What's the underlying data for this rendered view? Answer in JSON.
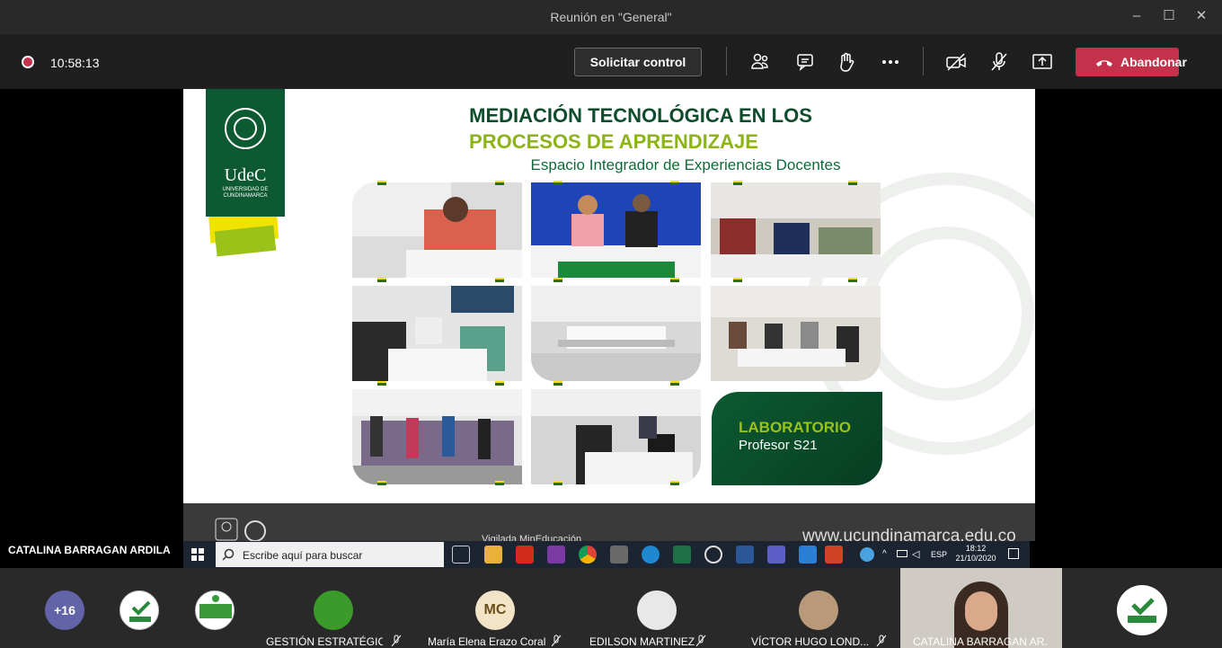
{
  "window": {
    "title": "Reunión en \"General\"",
    "controls": {
      "minimize": "–",
      "maximize": "☐",
      "close": "✕"
    }
  },
  "meeting_bar": {
    "timer": "10:58:13",
    "request_control_label": "Solicitar control",
    "leave_label": "Abandonar",
    "tools": [
      "participants-icon",
      "chat-icon",
      "raise-hand-icon",
      "more-icon",
      "camera-off-icon",
      "mic-off-icon",
      "share-tray-icon"
    ]
  },
  "slide": {
    "title_line1": "MEDIACIÓN TECNOLÓGICA EN LOS",
    "title_line2": "PROCESOS DE APRENDIZAJE",
    "subtitle": "Espacio Integrador de Experiencias Docentes",
    "logo": {
      "name": "UdeC",
      "university": "UNIVERSIDAD DE CUNDINAMARCA"
    },
    "lab_card": {
      "title": "LABORATORIO",
      "subtitle": "Profesor S21"
    },
    "footer": {
      "vigilada": "Vigilada MinEducación",
      "url": "www.ucundinamarca.edu.co"
    },
    "colors": {
      "dark_green": "#0e4d2b",
      "lime": "#8cb415",
      "yellow": "#f2e200"
    }
  },
  "presenter": {
    "name": "CATALINA BARRAGAN ARDILA"
  },
  "taskbar": {
    "search_placeholder": "Escribe aquí para buscar",
    "language": "ESP",
    "time": "18:12",
    "date": "21/10/2020"
  },
  "participants": {
    "more_count": "+16",
    "tiles": [
      {
        "name": "GESTIÓN ESTRATÉGIC...",
        "muted": true
      },
      {
        "name": "María Elena Erazo Coral",
        "initials": "MC",
        "muted": true
      },
      {
        "name": "EDILSON MARTINEZ",
        "muted": true
      },
      {
        "name": "VÍCTOR HUGO LOND...",
        "muted": true
      },
      {
        "name": "CATALINA BARRAGAN AR...",
        "muted": false
      }
    ]
  }
}
